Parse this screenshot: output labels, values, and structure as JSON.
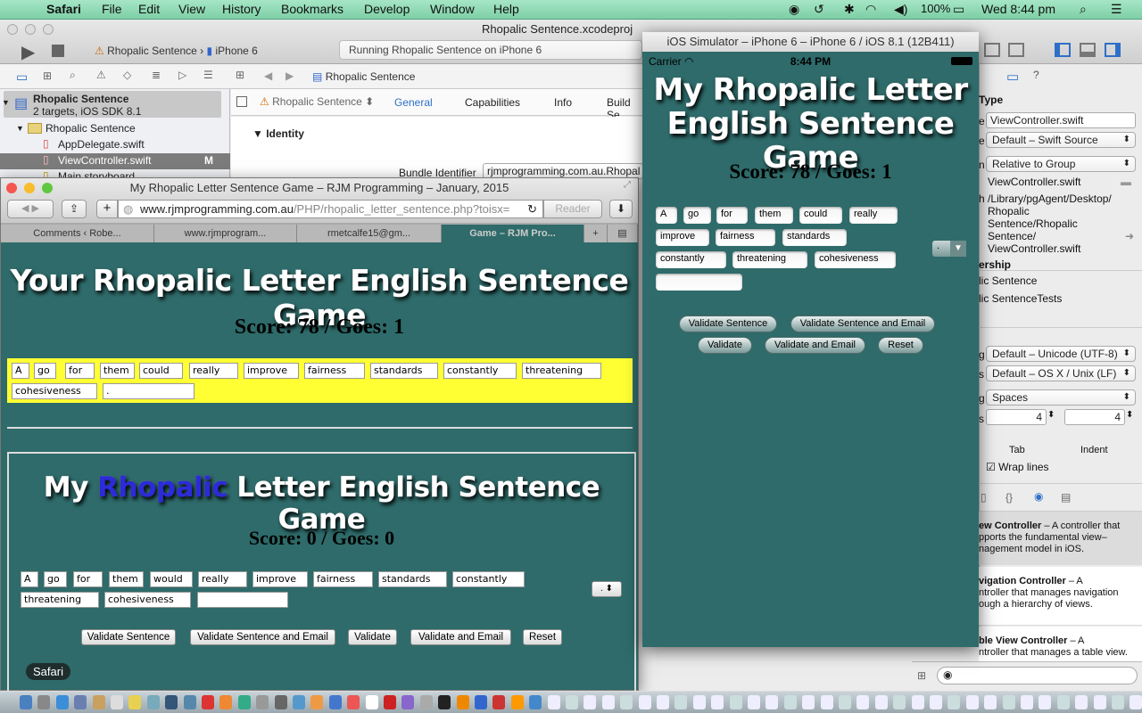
{
  "menubar": {
    "apple": "",
    "app": "Safari",
    "items": [
      "File",
      "Edit",
      "View",
      "History",
      "Bookmarks",
      "Develop",
      "Window",
      "Help"
    ],
    "battery": "100%",
    "clock": "Wed 8:44 pm"
  },
  "xcode": {
    "title": "Rhopalic Sentence.xcodeproj",
    "scheme": "Rhopalic Sentence",
    "device": "iPhone 6",
    "status": "Running Rhopalic Sentence on iPhone 6",
    "crumb": "Rhopalic Sentence",
    "navigator": {
      "project": "Rhopalic Sentence",
      "project_sub": "2 targets, iOS SDK 8.1",
      "group": "Rhopalic Sentence",
      "files": [
        "AppDelegate.swift",
        "ViewController.swift",
        "Main.storyboard"
      ],
      "badge": "M"
    },
    "editor": {
      "target": "Rhopalic Sentence",
      "tabs": [
        "General",
        "Capabilities",
        "Info",
        "Build Se"
      ],
      "section": "Identity",
      "bundle_label": "Bundle Identifier",
      "bundle_value": "rjmprogramming.com.au.Rhopal"
    },
    "inspector": {
      "type_header": "Type",
      "name_clip": "e",
      "name_value": "ViewController.swift",
      "type_clip": "e",
      "file_type": "Default – Swift Source",
      "loc_clip": "n",
      "location": "Relative to Group",
      "filename": "ViewController.swift",
      "path_clip": "h",
      "full_path": "/Library/pgAgent/Desktop/ Rhopalic Sentence/Rhopalic Sentence/ ViewController.swift",
      "membership_header": "ership",
      "targets": [
        "lic Sentence",
        "lic SentenceTests"
      ],
      "enc_clip": "g",
      "encoding": "Default – Unicode (UTF-8)",
      "le_clip": "s",
      "line_endings": "Default – OS X / Unix (LF)",
      "indent_clip": "g",
      "indent_using": "Spaces",
      "widths_clip": "s",
      "tab": "4",
      "indent": "4",
      "tab_label": "Tab",
      "indent_label": "Indent",
      "wrap": "Wrap lines",
      "library": [
        {
          "title": "ew Controller",
          "desc": " – A controller that",
          "l2": "pports the fundamental view–",
          "l3": "nagement model in iOS."
        },
        {
          "title": "vigation Controller",
          "desc": " – A",
          "l2": "ntroller that manages navigation",
          "l3": "ough a hierarchy of views."
        },
        {
          "title": "ble View Controller",
          "desc": " – A",
          "l2": "ntroller that manages a table view.",
          "l3": ""
        }
      ]
    }
  },
  "safari": {
    "title": "My Rhopalic Letter Sentence Game – RJM Programming – January, 2015",
    "url_domain": "www.rjmprogramming.com.au",
    "url_path": "/PHP/rhopalic_letter_sentence.php?toisx=",
    "reader": "Reader",
    "tabs": [
      "Comments ‹ Robe...",
      "www.rjmprogram...",
      "rmetcalfe15@gm...",
      "Game – RJM Pro..."
    ],
    "top": {
      "title": "Your Rhopalic Letter English Sentence Game",
      "score": "Score: 78 / Goes: 1",
      "words": [
        "A",
        "go",
        "for",
        "them",
        "could",
        "really",
        "improve",
        "fairness",
        "standards",
        "constantly",
        "threatening",
        "cohesiveness",
        "."
      ]
    },
    "bottom": {
      "title_pre": "My ",
      "title_hl": "Rhopalic",
      "title_post": " Letter English Sentence Game",
      "score": "Score: 0 / Goes: 0",
      "words": [
        "A",
        "go",
        "for",
        "them",
        "would",
        "really",
        "improve",
        "fairness",
        "standards",
        "constantly",
        "threatening",
        "cohesiveness",
        ""
      ],
      "select": ".",
      "buttons": [
        "Validate Sentence",
        "Validate Sentence and Email",
        "Validate",
        "Validate and Email",
        "Reset"
      ]
    },
    "tooltip": "Safari"
  },
  "simulator": {
    "title": "iOS Simulator – iPhone 6 – iPhone 6 / iOS 8.1 (12B411)",
    "carrier": "Carrier",
    "time": "8:44 PM",
    "title1": "My Rhopalic Letter",
    "title2": "English Sentence Game",
    "score": "Score: 78 / Goes: 1",
    "words": [
      "A",
      "go",
      "for",
      "them",
      "could",
      "really",
      "improve",
      "fairness",
      "standards",
      "constantly",
      "threatening",
      "cohesiveness",
      ""
    ],
    "select": ".",
    "buttons": [
      "Validate Sentence",
      "Validate Sentence and Email",
      "Validate",
      "Validate and Email",
      "Reset"
    ]
  },
  "colors": {
    "game_bg": "#2e6b6a",
    "highlight": "#ffff33",
    "link_blue": "#2b2bd9",
    "xcode_accent": "#2f6fc8"
  }
}
